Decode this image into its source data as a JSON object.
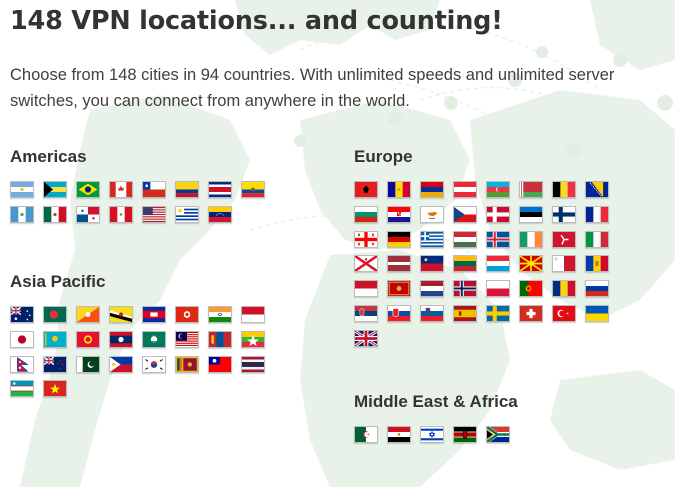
{
  "page": {
    "title": "148 VPN locations... and counting!",
    "intro": "Choose from 148 cities in 94 countries. With unlimited speeds and unlimited server switches, you can connect from anywhere in the world."
  },
  "theme": {
    "map_color": "#eaf3ea",
    "text_color": "#333333"
  },
  "regions": [
    {
      "id": "americas",
      "name": "Americas",
      "flags": [
        {
          "country": "Argentina",
          "flag": "argentina-flag"
        },
        {
          "country": "Bahamas",
          "flag": "bahamas-flag"
        },
        {
          "country": "Brazil",
          "flag": "brazil-flag"
        },
        {
          "country": "Canada",
          "flag": "canada-flag"
        },
        {
          "country": "Chile",
          "flag": "chile-flag"
        },
        {
          "country": "Colombia",
          "flag": "colombia-flag"
        },
        {
          "country": "Costa Rica",
          "flag": "costa-rica-flag"
        },
        {
          "country": "Ecuador",
          "flag": "ecuador-flag"
        },
        {
          "country": "Guatemala",
          "flag": "guatemala-flag"
        },
        {
          "country": "Mexico",
          "flag": "mexico-flag"
        },
        {
          "country": "Panama",
          "flag": "panama-flag"
        },
        {
          "country": "Peru",
          "flag": "peru-flag"
        },
        {
          "country": "United States",
          "flag": "united-states-flag"
        },
        {
          "country": "Uruguay",
          "flag": "uruguay-flag"
        },
        {
          "country": "Venezuela",
          "flag": "venezuela-flag"
        }
      ]
    },
    {
      "id": "asia-pacific",
      "name": "Asia Pacific",
      "flags": [
        {
          "country": "Australia",
          "flag": "australia-flag"
        },
        {
          "country": "Bangladesh",
          "flag": "bangladesh-flag"
        },
        {
          "country": "Bhutan",
          "flag": "bhutan-flag"
        },
        {
          "country": "Brunei",
          "flag": "brunei-flag"
        },
        {
          "country": "Cambodia",
          "flag": "cambodia-flag"
        },
        {
          "country": "Hong Kong",
          "flag": "hong-kong-flag"
        },
        {
          "country": "India",
          "flag": "india-flag"
        },
        {
          "country": "Indonesia",
          "flag": "indonesia-flag"
        },
        {
          "country": "Japan",
          "flag": "japan-flag"
        },
        {
          "country": "Kazakhstan",
          "flag": "kazakhstan-flag"
        },
        {
          "country": "Kyrgyzstan",
          "flag": "kyrgyzstan-flag"
        },
        {
          "country": "Laos",
          "flag": "laos-flag"
        },
        {
          "country": "Macau",
          "flag": "macau-flag"
        },
        {
          "country": "Malaysia",
          "flag": "malaysia-flag"
        },
        {
          "country": "Mongolia",
          "flag": "mongolia-flag"
        },
        {
          "country": "Myanmar",
          "flag": "myanmar-flag"
        },
        {
          "country": "Nepal",
          "flag": "nepal-flag"
        },
        {
          "country": "New Zealand",
          "flag": "new-zealand-flag"
        },
        {
          "country": "Pakistan",
          "flag": "pakistan-flag"
        },
        {
          "country": "Philippines",
          "flag": "philippines-flag"
        },
        {
          "country": "South Korea",
          "flag": "south-korea-flag"
        },
        {
          "country": "Sri Lanka",
          "flag": "sri-lanka-flag"
        },
        {
          "country": "Taiwan",
          "flag": "taiwan-flag"
        },
        {
          "country": "Thailand",
          "flag": "thailand-flag"
        },
        {
          "country": "Uzbekistan",
          "flag": "uzbekistan-flag"
        },
        {
          "country": "Vietnam",
          "flag": "vietnam-flag"
        }
      ]
    },
    {
      "id": "europe",
      "name": "Europe",
      "flags": [
        {
          "country": "Albania",
          "flag": "albania-flag"
        },
        {
          "country": "Andorra",
          "flag": "andorra-flag"
        },
        {
          "country": "Armenia",
          "flag": "armenia-flag"
        },
        {
          "country": "Austria",
          "flag": "austria-flag"
        },
        {
          "country": "Azerbaijan",
          "flag": "azerbaijan-flag"
        },
        {
          "country": "Belarus",
          "flag": "belarus-flag"
        },
        {
          "country": "Belgium",
          "flag": "belgium-flag"
        },
        {
          "country": "Bosnia and Herzegovina",
          "flag": "bosnia-flag"
        },
        {
          "country": "Bulgaria",
          "flag": "bulgaria-flag"
        },
        {
          "country": "Croatia",
          "flag": "croatia-flag"
        },
        {
          "country": "Cyprus",
          "flag": "cyprus-flag"
        },
        {
          "country": "Czech Republic",
          "flag": "czech-republic-flag"
        },
        {
          "country": "Denmark",
          "flag": "denmark-flag"
        },
        {
          "country": "Estonia",
          "flag": "estonia-flag"
        },
        {
          "country": "Finland",
          "flag": "finland-flag"
        },
        {
          "country": "France",
          "flag": "france-flag"
        },
        {
          "country": "Georgia",
          "flag": "georgia-flag"
        },
        {
          "country": "Germany",
          "flag": "germany-flag"
        },
        {
          "country": "Greece",
          "flag": "greece-flag"
        },
        {
          "country": "Hungary",
          "flag": "hungary-flag"
        },
        {
          "country": "Iceland",
          "flag": "iceland-flag"
        },
        {
          "country": "Ireland",
          "flag": "ireland-flag"
        },
        {
          "country": "Isle of Man",
          "flag": "isle-of-man-flag"
        },
        {
          "country": "Italy",
          "flag": "italy-flag"
        },
        {
          "country": "Jersey",
          "flag": "jersey-flag"
        },
        {
          "country": "Latvia",
          "flag": "latvia-flag"
        },
        {
          "country": "Liechtenstein",
          "flag": "liechtenstein-flag"
        },
        {
          "country": "Lithuania",
          "flag": "lithuania-flag"
        },
        {
          "country": "Luxembourg",
          "flag": "luxembourg-flag"
        },
        {
          "country": "North Macedonia",
          "flag": "north-macedonia-flag"
        },
        {
          "country": "Malta",
          "flag": "malta-flag"
        },
        {
          "country": "Moldova",
          "flag": "moldova-flag"
        },
        {
          "country": "Monaco",
          "flag": "monaco-flag"
        },
        {
          "country": "Montenegro",
          "flag": "montenegro-flag"
        },
        {
          "country": "Netherlands",
          "flag": "netherlands-flag"
        },
        {
          "country": "Norway",
          "flag": "norway-flag"
        },
        {
          "country": "Poland",
          "flag": "poland-flag"
        },
        {
          "country": "Portugal",
          "flag": "portugal-flag"
        },
        {
          "country": "Romania",
          "flag": "romania-flag"
        },
        {
          "country": "Russia",
          "flag": "russia-flag"
        },
        {
          "country": "Serbia",
          "flag": "serbia-flag"
        },
        {
          "country": "Slovakia",
          "flag": "slovakia-flag"
        },
        {
          "country": "Slovenia",
          "flag": "slovenia-flag"
        },
        {
          "country": "Spain",
          "flag": "spain-flag"
        },
        {
          "country": "Sweden",
          "flag": "sweden-flag"
        },
        {
          "country": "Switzerland",
          "flag": "switzerland-flag"
        },
        {
          "country": "Turkey",
          "flag": "turkey-flag"
        },
        {
          "country": "Ukraine",
          "flag": "ukraine-flag"
        },
        {
          "country": "United Kingdom",
          "flag": "united-kingdom-flag"
        }
      ]
    },
    {
      "id": "middle-east-africa",
      "name": "Middle East & Africa",
      "flags": [
        {
          "country": "Algeria",
          "flag": "algeria-flag"
        },
        {
          "country": "Egypt",
          "flag": "egypt-flag"
        },
        {
          "country": "Israel",
          "flag": "israel-flag"
        },
        {
          "country": "Kenya",
          "flag": "kenya-flag"
        },
        {
          "country": "South Africa",
          "flag": "south-africa-flag"
        }
      ]
    }
  ]
}
